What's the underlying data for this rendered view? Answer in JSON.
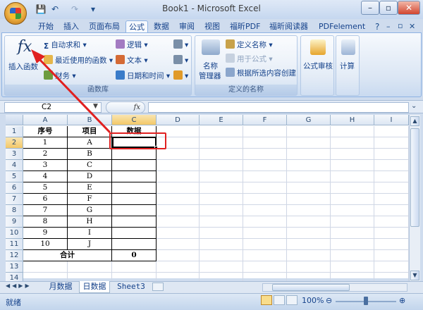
{
  "window": {
    "title": "Book1 - Microsoft Excel"
  },
  "quick_access": {
    "save_icon": "save-icon",
    "undo_icon": "undo-icon",
    "redo_icon": "redo-icon"
  },
  "window_controls": {
    "minimize": "–",
    "restore": "▫",
    "close": "✕",
    "help": "?",
    "ribbon_min": "–",
    "ribbon_restore": "▫",
    "ribbon_close": "✕"
  },
  "tabs": [
    "开始",
    "插入",
    "页面布局",
    "公式",
    "数据",
    "审阅",
    "视图",
    "福昕PDF",
    "福昕阅读器",
    "PDFelement"
  ],
  "active_tab": "公式",
  "ribbon": {
    "function_library": {
      "label": "函数库",
      "insert_function": "插入函数",
      "fx": "fx",
      "autosum": "自动求和",
      "recent": "最近使用的函数",
      "finance": "财务",
      "logic": "逻辑",
      "text": "文本",
      "datetime": "日期和时间"
    },
    "defined_names": {
      "label": "定义的名称",
      "name_manager_1": "名称",
      "name_manager_2": "管理器",
      "define_name": "定义名称",
      "use_in_formula": "用于公式",
      "create_from_selection": "根据所选内容创建"
    },
    "audit": {
      "label": "公式审核"
    },
    "calc": {
      "label": "计算"
    }
  },
  "formula_bar": {
    "name_box": "C2",
    "fx": "fx",
    "value": ""
  },
  "columns": [
    "A",
    "B",
    "C",
    "D",
    "E",
    "F",
    "G",
    "H",
    "I"
  ],
  "rows": [
    "1",
    "2",
    "3",
    "4",
    "5",
    "6",
    "7",
    "8",
    "9",
    "10",
    "11",
    "12",
    "13",
    "14"
  ],
  "table": {
    "headers": [
      "序号",
      "项目",
      "数据"
    ],
    "numbers": [
      "1",
      "2",
      "3",
      "4",
      "5",
      "6",
      "7",
      "8",
      "9",
      "10"
    ],
    "items": [
      "A",
      "B",
      "C",
      "D",
      "E",
      "F",
      "G",
      "H",
      "I",
      "J"
    ],
    "total_label": "合计",
    "total_value": "0"
  },
  "sheets": [
    "月数据",
    "日数据",
    "Sheet3"
  ],
  "active_sheet": "日数据",
  "status": {
    "ready": "就绪",
    "zoom": "100%"
  },
  "colors": {
    "accent": "#e02020",
    "selection": "#f3c868",
    "ribbon": "#dbe6f4"
  }
}
